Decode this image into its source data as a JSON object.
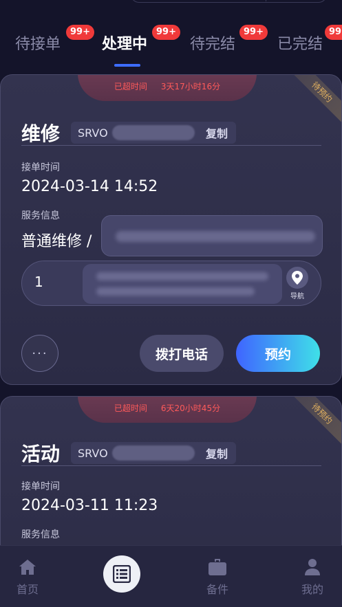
{
  "tabs": [
    {
      "label": "待接单",
      "badge": "99+"
    },
    {
      "label": "处理中",
      "badge": "99+",
      "active": true
    },
    {
      "label": "待完结",
      "badge": "99+"
    },
    {
      "label": "已完结",
      "badge": "99+"
    }
  ],
  "cards": [
    {
      "overtime_label": "已超时间",
      "overtime_value": "3天17小时16分",
      "corner_tag": "待预约",
      "title": "维修",
      "code_prefix": "SRVO",
      "copy_label": "复制",
      "accept_time_label": "接单时间",
      "accept_time": "2024-03-14 14:52",
      "service_label": "服务信息",
      "service_type": "普通维修 /",
      "address_number": "1",
      "nav_label": "导航",
      "more_label": "···",
      "call_label": "拨打电话",
      "book_label": "预约"
    },
    {
      "overtime_label": "已超时间",
      "overtime_value": "6天20小时45分",
      "corner_tag": "待预约",
      "title": "活动",
      "code_prefix": "SRVO",
      "copy_label": "复制",
      "accept_time_label": "接单时间",
      "accept_time": "2024-03-11 11:23",
      "service_label": "服务信息"
    }
  ],
  "bottom_nav": {
    "home": "首页",
    "parts": "备件",
    "mine": "我的"
  },
  "colors": {
    "accent_blue": "#3f64ff",
    "accent_cyan": "#3fe0e8",
    "badge_red": "#f03a3a",
    "overtime_red": "#ff5a5a",
    "tag_gold": "#e0b060"
  }
}
